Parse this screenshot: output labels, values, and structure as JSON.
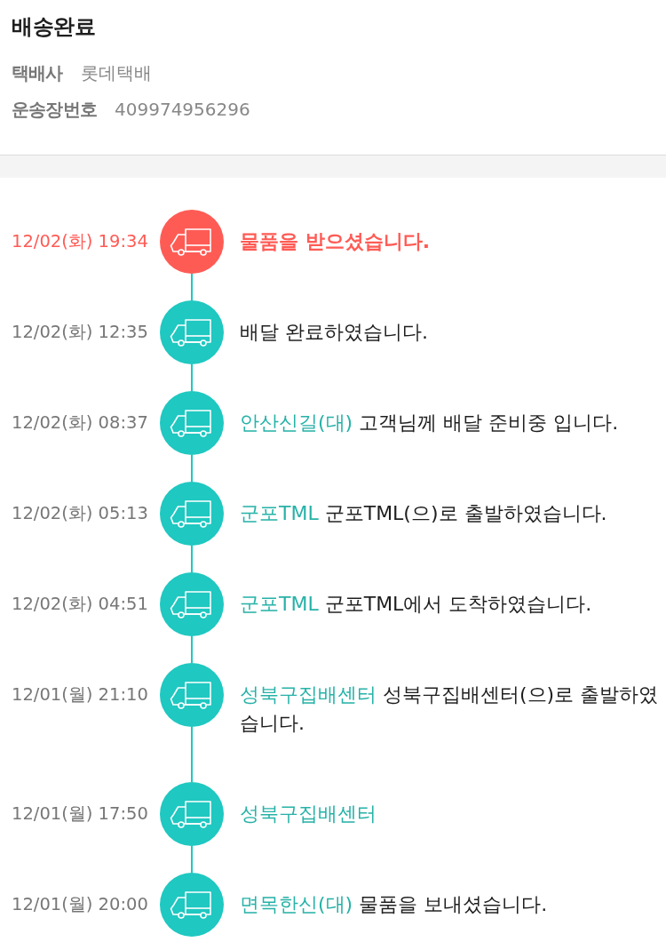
{
  "header": {
    "title": "배송완료",
    "info": [
      {
        "label": "택배사",
        "value": "롯데택배"
      },
      {
        "label": "운송장번호",
        "value": "409974956296"
      }
    ]
  },
  "timeline": [
    {
      "time": "12/02(화) 19:34",
      "message": "물품을 받으셨습니다.",
      "current": true
    },
    {
      "time": "12/02(화) 12:35",
      "message": "배달 완료하였습니다.",
      "current": false
    },
    {
      "time": "12/02(화) 08:37",
      "location": "안산신길(대)",
      "message": "고객님께 배달 준비중 입니다.",
      "current": false
    },
    {
      "time": "12/02(화) 05:13",
      "location": "군포TML",
      "message": "군포TML(으)로 출발하였습니다.",
      "current": false
    },
    {
      "time": "12/02(화) 04:51",
      "location": "군포TML",
      "message": "군포TML에서 도착하였습니다.",
      "current": false
    },
    {
      "time": "12/01(월) 21:10",
      "location": "성북구집배센터",
      "message": "성북구집배센터(으)로 출발하였습니다.",
      "current": false
    },
    {
      "time": "12/01(월) 17:50",
      "location": "성북구집배센터",
      "current": false
    },
    {
      "time": "12/01(월) 20:00",
      "location": "면목한신(대)",
      "message": "물품을 보내셨습니다.",
      "current": false
    }
  ]
}
